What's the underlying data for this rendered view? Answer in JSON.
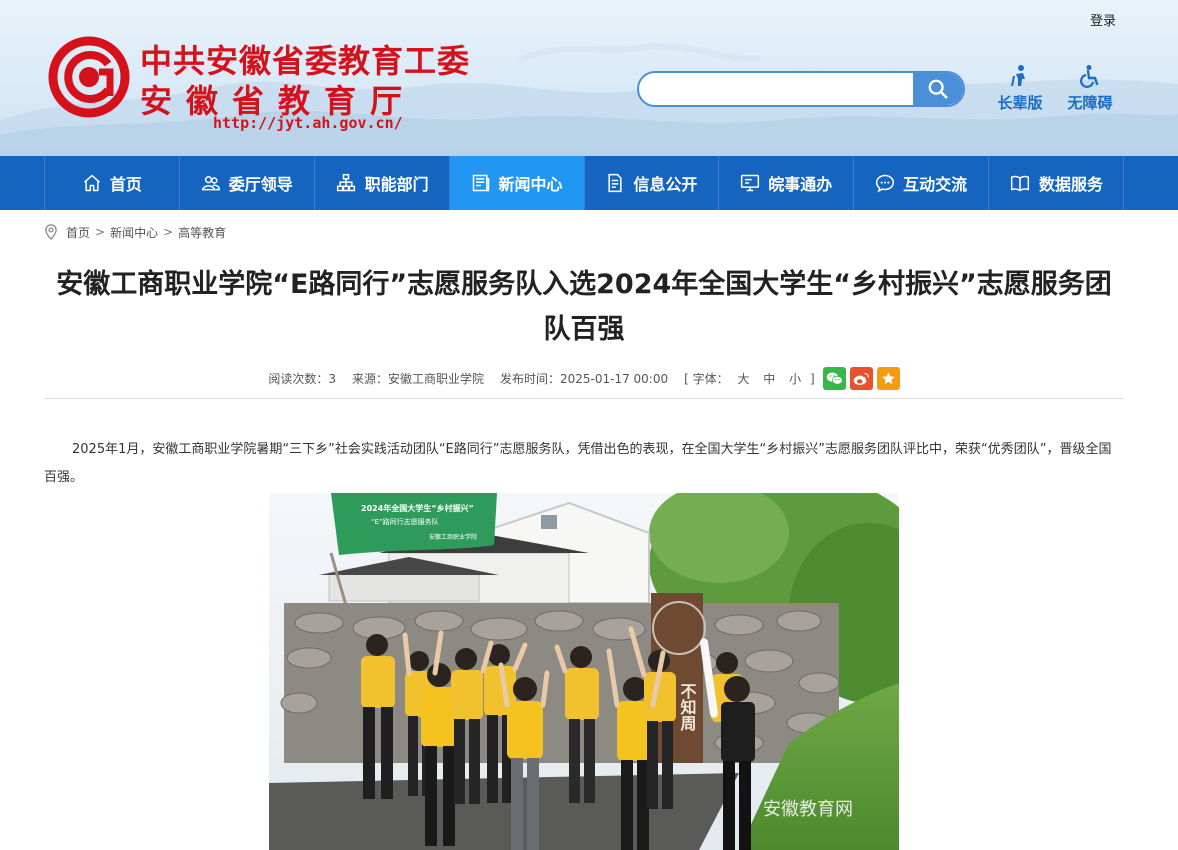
{
  "header": {
    "login_label": "登录",
    "org_line1": "中共安徽省委教育工委",
    "org_line2": "安徽省教育厅",
    "url": "http://jyt.ah.gov.cn/",
    "search": {
      "placeholder": "",
      "value": ""
    },
    "tools": [
      {
        "label": "长辈版",
        "icon": "elder-icon"
      },
      {
        "label": "无障碍",
        "icon": "wheelchair-icon"
      }
    ],
    "brand_color": "#d5121b"
  },
  "nav": {
    "items": [
      {
        "label": "首页",
        "icon": "home-icon",
        "active": false
      },
      {
        "label": "委厅领导",
        "icon": "people-icon",
        "active": false
      },
      {
        "label": "职能部门",
        "icon": "org-chart-icon",
        "active": false
      },
      {
        "label": "新闻中心",
        "icon": "news-icon",
        "active": true
      },
      {
        "label": "信息公开",
        "icon": "document-icon",
        "active": false
      },
      {
        "label": "皖事通办",
        "icon": "monitor-icon",
        "active": false
      },
      {
        "label": "互动交流",
        "icon": "chat-icon",
        "active": false
      },
      {
        "label": "数据服务",
        "icon": "book-icon",
        "active": false
      }
    ],
    "bg_color": "#1565c0",
    "active_color": "#2196f3"
  },
  "breadcrumb": {
    "items": [
      "首页",
      "新闻中心",
      "高等教育"
    ],
    "separator": ">"
  },
  "article": {
    "title": "安徽工商职业学院“E路同行”志愿服务队入选2024年全国大学生“乡村振兴”志愿服务团队百强",
    "meta": {
      "reads_label": "阅读次数：",
      "reads_value": "3",
      "source": "来源：安徽工商职业学院",
      "publish": "发布时间：2025-01-17 00:00",
      "font_open": "[ 字体：",
      "font_sizes": [
        "大",
        "中",
        "小"
      ],
      "font_close": "]"
    },
    "share": [
      {
        "name": "wechat-icon",
        "color": "#3ab54a"
      },
      {
        "name": "weibo-icon",
        "color": "#e6522c"
      },
      {
        "name": "favorite-icon",
        "color": "#f39c12"
      }
    ],
    "paragraph": "2025年1月，安徽工商职业学院暑期“三下乡”社会实践活动团队“E路同行”志愿服务队，凭借出色的表现，在全国大学生“乡村振兴”志愿服务团队评比中，荣获“优秀团队”，晋级全国百强。",
    "photo": {
      "flag_line1": "2024年全国大学生“乡村振兴”",
      "flag_line2": "“E”路同行志愿服务队",
      "flag_line3": "安徽工商职业学院",
      "sign_text": "不知周",
      "watermark": "安徽教育网"
    }
  }
}
